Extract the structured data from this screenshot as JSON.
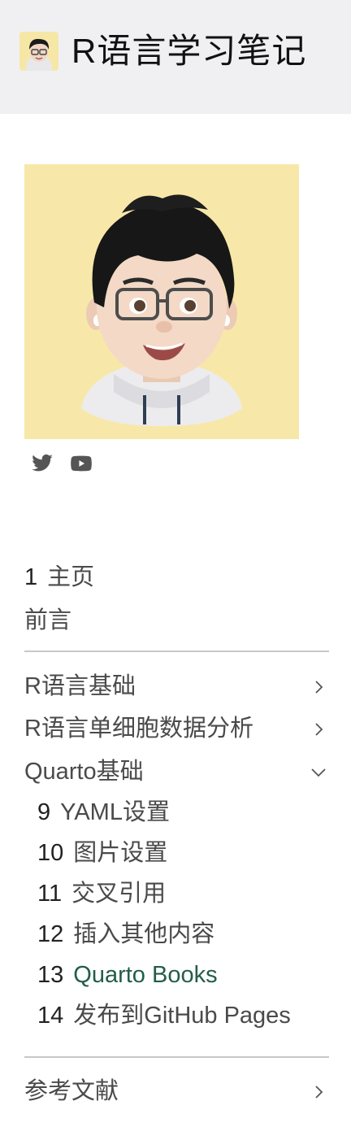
{
  "header": {
    "title": "R语言学习笔记",
    "logo_icon": "avatar-icon"
  },
  "social": [
    {
      "icon": "twitter-icon"
    },
    {
      "icon": "youtube-icon"
    }
  ],
  "nav": {
    "home": {
      "num": "1",
      "label": "主页"
    },
    "preface": {
      "label": "前言"
    },
    "sections": [
      {
        "label": "R语言基础",
        "state": "collapsed"
      },
      {
        "label": "R语言单细胞数据分析",
        "state": "collapsed"
      },
      {
        "label": "Quarto基础",
        "state": "expanded"
      }
    ],
    "quarto_items": [
      {
        "num": "9",
        "label": "YAML设置"
      },
      {
        "num": "10",
        "label": "图片设置"
      },
      {
        "num": "11",
        "label": "交叉引用"
      },
      {
        "num": "12",
        "label": "插入其他内容"
      },
      {
        "num": "13",
        "label": "Quarto Books",
        "active": true
      },
      {
        "num": "14",
        "label": "发布到GitHub Pages"
      }
    ],
    "references": {
      "label": "参考文献",
      "state": "collapsed"
    }
  },
  "colors": {
    "active_link": "#245d4a",
    "header_bg": "#f0f0f2",
    "avatar_bg": "#f7e8a9"
  }
}
